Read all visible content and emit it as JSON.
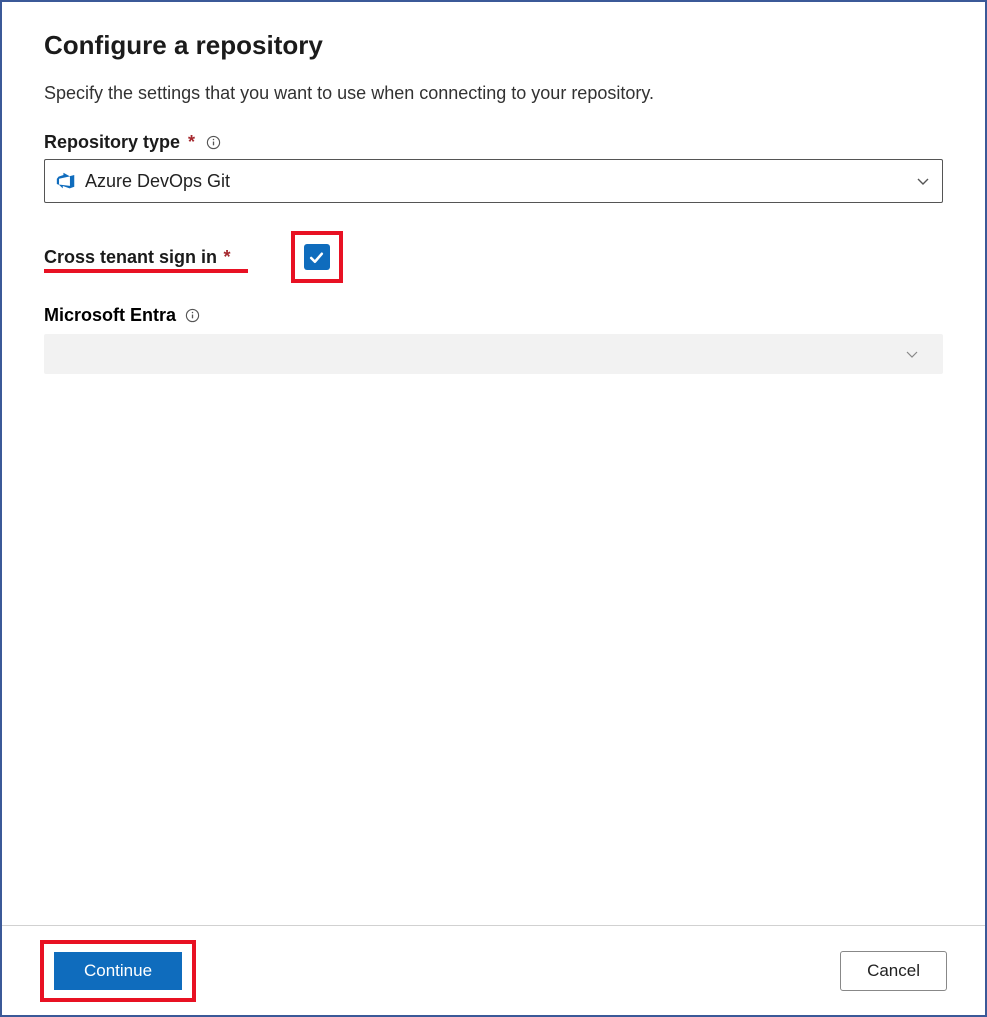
{
  "header": {
    "title": "Configure a repository",
    "subtitle": "Specify the settings that you want to use when connecting to your repository."
  },
  "form": {
    "repositoryType": {
      "label": "Repository type",
      "required": true,
      "selected": "Azure DevOps Git"
    },
    "crossTenant": {
      "label": "Cross tenant sign in",
      "required": true,
      "checked": true
    },
    "microsoftEntra": {
      "label": "Microsoft Entra",
      "selected": ""
    }
  },
  "footer": {
    "continueLabel": "Continue",
    "cancelLabel": "Cancel"
  },
  "colors": {
    "primary": "#0f6cbd",
    "highlight": "#e81123",
    "required": "#a4262c"
  }
}
